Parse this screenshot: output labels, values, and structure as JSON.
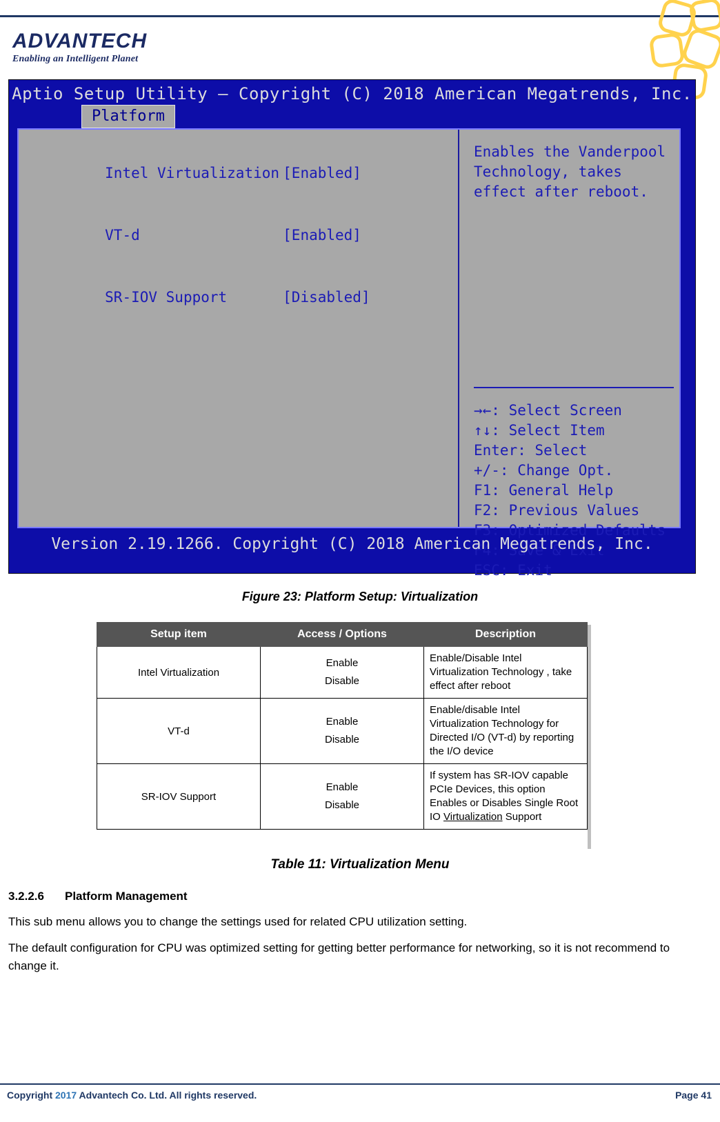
{
  "header": {
    "logo_word": "ADVANTECH",
    "logo_tagline": "Enabling an Intelligent Planet"
  },
  "bios": {
    "title": "Aptio Setup Utility – Copyright (C) 2018 American Megatrends, Inc.",
    "tab": "Platform",
    "settings": [
      {
        "label": "Intel Virtualization",
        "value": "[Enabled]"
      },
      {
        "label": "VT-d",
        "value": "[Enabled]"
      },
      {
        "label": "SR-IOV Support",
        "value": "[Disabled]"
      }
    ],
    "help": "Enables the Vanderpool Technology, takes effect after reboot.",
    "keys": "→←: Select Screen\n↑↓: Select Item\nEnter: Select\n+/-: Change Opt.\nF1: General Help\nF2: Previous Values\nF3: Optimized Defaults\nF4: Save & Exit\nESC: Exit",
    "version": "Version 2.19.1266. Copyright (C) 2018 American Megatrends, Inc."
  },
  "figure_caption": "Figure 23: Platform Setup: Virtualization",
  "table": {
    "headers": [
      "Setup item",
      "Access / Options",
      "Description"
    ],
    "rows": [
      {
        "item": "Intel Virtualization",
        "options": "Enable\nDisable",
        "description": "Enable/Disable Intel Virtualization Technology , take effect after reboot"
      },
      {
        "item": "VT-d",
        "options": "Enable\nDisable",
        "description": "Enable/disable Intel Virtualization Technology for Directed I/O (VT-d) by reporting the I/O device"
      },
      {
        "item": "SR-IOV Support",
        "options": "Enable\nDisable",
        "description_pre": "If system has SR-IOV capable PCIe Devices, this option Enables or Disables Single Root IO ",
        "description_underlined": "Virtualization",
        "description_post": " Support"
      }
    ],
    "caption": "Table 11: Virtualization Menu"
  },
  "section": {
    "number": "3.2.2.6",
    "heading": "Platform Management",
    "paragraph1": "This sub menu allows you to change the settings used for related CPU utilization setting.",
    "paragraph2": "The default configuration for CPU was optimized setting for getting better performance for networking, so it is not recommend to change it."
  },
  "footer": {
    "copyright_pre": "Copyright ",
    "copyright_year": "2017",
    "copyright_post": "  Advantech Co. Ltd. All rights reserved.",
    "page": "Page 41"
  }
}
